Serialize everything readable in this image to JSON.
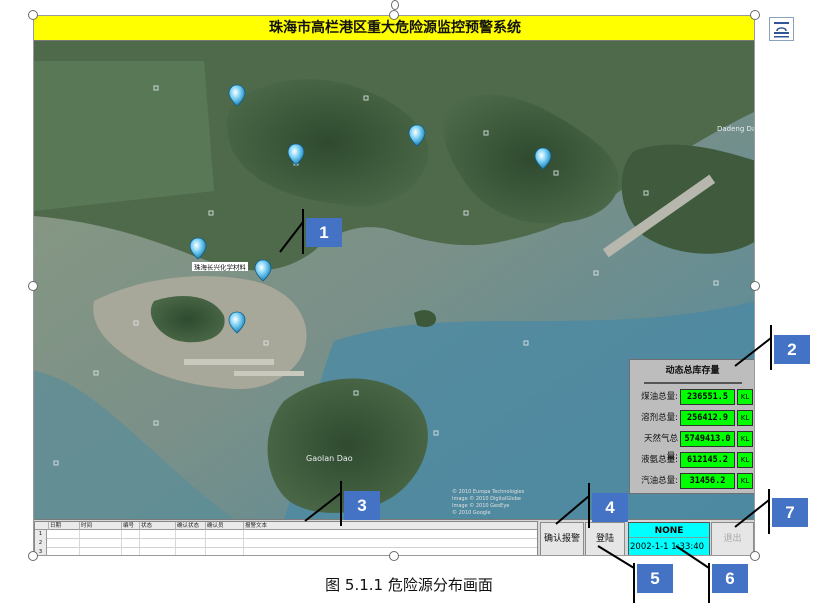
{
  "app": {
    "title": "珠海市高栏港区重大危险源监控预警系统"
  },
  "map": {
    "place_labels": [
      "Gaolan Dao",
      "Dadeng Dao",
      "珠海长兴化学材料"
    ],
    "imagery_credit": [
      "© 2010 Europa Technologies",
      "Image © 2010 DigitalGlobe",
      "Image © 2010 GeoEye",
      "© 2010 Google"
    ]
  },
  "inventory": {
    "title": "动态总库存量",
    "rows": [
      {
        "label": "煤油总量:",
        "value": "236551.5",
        "unit": "KL"
      },
      {
        "label": "溶剂总量:",
        "value": "256412.9",
        "unit": "KL"
      },
      {
        "label": "天然气总量:",
        "value": "5749413.0",
        "unit": "KL"
      },
      {
        "label": "液氨总量:",
        "value": "612145.2",
        "unit": "KL"
      },
      {
        "label": "汽油总量:",
        "value": "31456.2",
        "unit": "KL"
      }
    ]
  },
  "alarm_table": {
    "columns": [
      "日期",
      "时间",
      "编号",
      "状态",
      "确认状态",
      "确认员",
      "报警文本"
    ],
    "row_numbers": [
      "1",
      "2",
      "3",
      "4"
    ]
  },
  "buttons": {
    "ack_label": "确认报警",
    "login_label": "登陆",
    "exit_label": "退出"
  },
  "status": {
    "user": "NONE",
    "datetime": "2002-1-1 1:33:40"
  },
  "callouts": [
    "1",
    "2",
    "3",
    "4",
    "5",
    "6",
    "7"
  ],
  "caption": "图  5.1.1  危险源分布画面",
  "colors": {
    "title_bar": "#ffff00",
    "value_box": "#00ff00",
    "status_box": "#00ffff",
    "callout": "#4472c4",
    "panel": "#bdbdbd"
  },
  "icons": [
    "location-pin-icon",
    "text-wrap-layout-icon"
  ]
}
